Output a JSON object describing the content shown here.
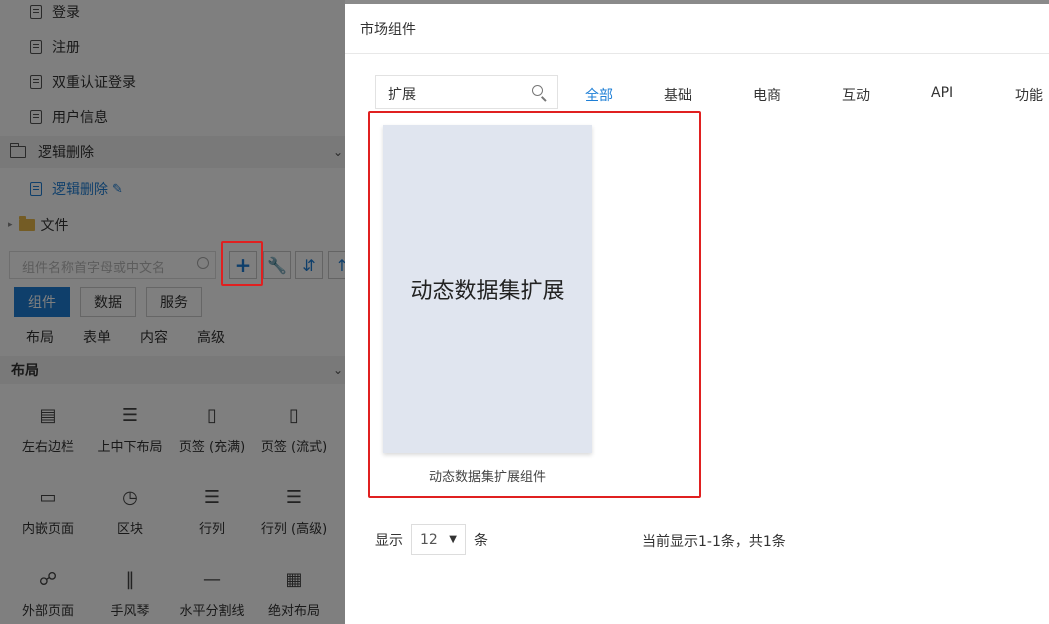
{
  "sidebar": {
    "tree_items": [
      {
        "label": "登录"
      },
      {
        "label": "注册"
      },
      {
        "label": "双重认证登录"
      },
      {
        "label": "用户信息"
      }
    ],
    "group_label": "逻辑删除",
    "active_item": "逻辑删除",
    "file_folder": "文件",
    "search_placeholder": "组件名称首字母或中文名",
    "add_button": "+",
    "tabs": [
      "组件",
      "数据",
      "服务"
    ],
    "sub_tabs": [
      "布局",
      "表单",
      "内容",
      "高级"
    ],
    "section_title": "布局",
    "components": [
      {
        "label": "左右边栏",
        "icon": "sidebar-layout-icon"
      },
      {
        "label": "上中下布局",
        "icon": "stack-layout-icon"
      },
      {
        "label": "页签 (充满)",
        "icon": "tab-fill-icon"
      },
      {
        "label": "页签 (流式)",
        "icon": "tab-flow-icon"
      },
      {
        "label": "内嵌页面",
        "icon": "embed-page-icon"
      },
      {
        "label": "区块",
        "icon": "block-icon"
      },
      {
        "label": "行列",
        "icon": "rows-icon"
      },
      {
        "label": "行列 (高级)",
        "icon": "rows-advanced-icon"
      },
      {
        "label": "外部页面",
        "icon": "globe-icon"
      },
      {
        "label": "手风琴",
        "icon": "accordion-icon"
      },
      {
        "label": "水平分割线",
        "icon": "divider-icon"
      },
      {
        "label": "绝对布局",
        "icon": "grid-icon"
      }
    ]
  },
  "dialog": {
    "title": "市场组件",
    "search_value": "扩展",
    "categories": [
      "全部",
      "基础",
      "电商",
      "互动",
      "API",
      "功能"
    ],
    "active_category": "全部",
    "card_title": "动态数据集扩展",
    "card_caption": "动态数据集扩展组件",
    "pager": {
      "show_label": "显示",
      "page_size": "12",
      "unit": "条",
      "summary": "当前显示1-1条，共1条"
    }
  },
  "colors": {
    "accent": "#1e7fd6",
    "highlight": "#e02020"
  }
}
